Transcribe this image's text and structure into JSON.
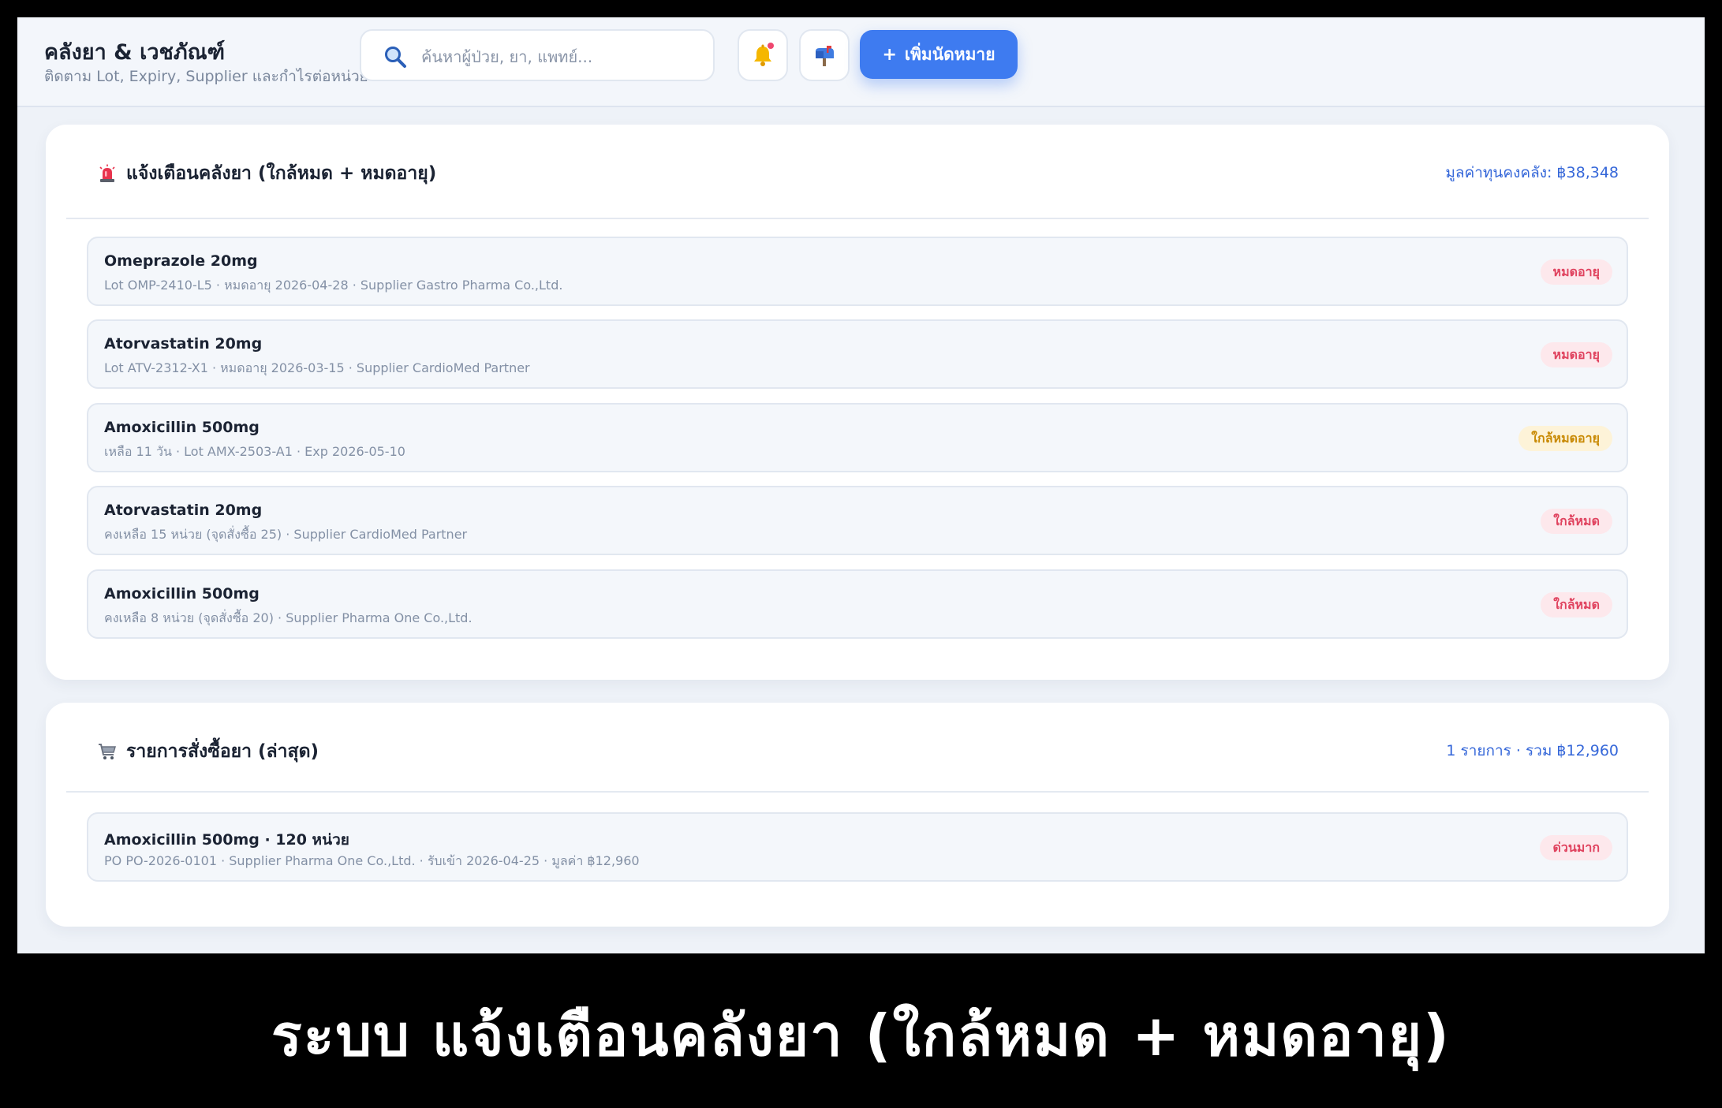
{
  "header": {
    "title": "คลังยา & เวชภัณฑ์",
    "subtitle": "ติดตาม Lot, Expiry, Supplier และกำไรต่อหน่วย",
    "search_placeholder": "ค้นหาผู้ป่วย, ยา, แพทย์...",
    "add_button_label": "เพิ่มนัดหมาย",
    "add_button_plus": "+"
  },
  "alerts": {
    "title": "แจ้งเตือนคลังยา (ใกล้หมด + หมดอายุ)",
    "summary": "มูลค่าทุนคงคลัง: ฿38,348",
    "items": [
      {
        "name": "Omeprazole 20mg",
        "detail": "Lot OMP-2410-L5 · หมดอายุ 2026-04-28 · Supplier Gastro Pharma Co.,Ltd.",
        "badge": "หมดอายุ"
      },
      {
        "name": "Atorvastatin 20mg",
        "detail": "Lot ATV-2312-X1 · หมดอายุ 2026-03-15 · Supplier CardioMed Partner",
        "badge": "หมดอายุ"
      },
      {
        "name": "Amoxicillin 500mg",
        "detail": "เหลือ 11 วัน · Lot AMX-2503-A1 · Exp 2026-05-10",
        "badge": "ใกล้หมดอายุ"
      },
      {
        "name": "Atorvastatin 20mg",
        "detail": "คงเหลือ 15 หน่วย (จุดสั่งซื้อ 25) · Supplier CardioMed Partner",
        "badge": "ใกล้หมด"
      },
      {
        "name": "Amoxicillin 500mg",
        "detail": "คงเหลือ 8 หน่วย (จุดสั่งซื้อ 20) · Supplier Pharma One Co.,Ltd.",
        "badge": "ใกล้หมด"
      }
    ]
  },
  "orders": {
    "title": "รายการสั่งซื้อยา (ล่าสุด)",
    "summary": "1 รายการ · รวม ฿12,960",
    "items": [
      {
        "name": "Amoxicillin 500mg · 120 หน่วย",
        "detail": "PO PO-2026-0101 · Supplier Pharma One Co.,Ltd. · รับเข้า 2026-04-25 · มูลค่า ฿12,960",
        "badge": "ด่วนมาก"
      }
    ]
  },
  "caption": "ระบบ แจ้งเตือนคลังยา (ใกล้หมด + หมดอายุ)",
  "colors": {
    "accent": "#3e7bf0",
    "badge_red": "#e0435f",
    "badge_amber": "#c98a05"
  },
  "icons": {
    "search": "search-icon",
    "bell": "bell-icon",
    "mailbox": "mailbox-icon",
    "siren": "siren-icon",
    "cart": "cart-icon"
  }
}
